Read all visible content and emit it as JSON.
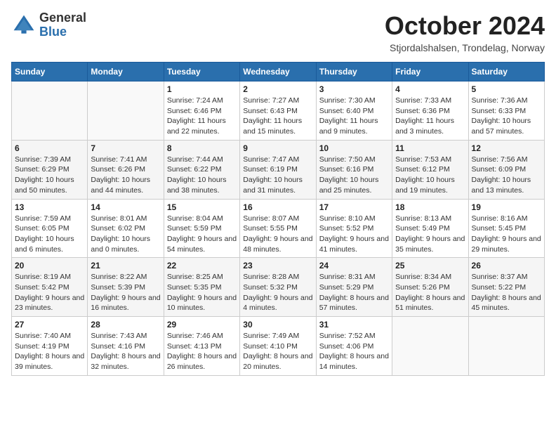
{
  "header": {
    "logo": {
      "general": "General",
      "blue": "Blue"
    },
    "title": "October 2024",
    "location": "Stjordalshalsen, Trondelag, Norway"
  },
  "days_of_week": [
    "Sunday",
    "Monday",
    "Tuesday",
    "Wednesday",
    "Thursday",
    "Friday",
    "Saturday"
  ],
  "weeks": [
    [
      {
        "day": "",
        "info": ""
      },
      {
        "day": "",
        "info": ""
      },
      {
        "day": "1",
        "info": "Sunrise: 7:24 AM\nSunset: 6:46 PM\nDaylight: 11 hours and 22 minutes."
      },
      {
        "day": "2",
        "info": "Sunrise: 7:27 AM\nSunset: 6:43 PM\nDaylight: 11 hours and 15 minutes."
      },
      {
        "day": "3",
        "info": "Sunrise: 7:30 AM\nSunset: 6:40 PM\nDaylight: 11 hours and 9 minutes."
      },
      {
        "day": "4",
        "info": "Sunrise: 7:33 AM\nSunset: 6:36 PM\nDaylight: 11 hours and 3 minutes."
      },
      {
        "day": "5",
        "info": "Sunrise: 7:36 AM\nSunset: 6:33 PM\nDaylight: 10 hours and 57 minutes."
      }
    ],
    [
      {
        "day": "6",
        "info": "Sunrise: 7:39 AM\nSunset: 6:29 PM\nDaylight: 10 hours and 50 minutes."
      },
      {
        "day": "7",
        "info": "Sunrise: 7:41 AM\nSunset: 6:26 PM\nDaylight: 10 hours and 44 minutes."
      },
      {
        "day": "8",
        "info": "Sunrise: 7:44 AM\nSunset: 6:22 PM\nDaylight: 10 hours and 38 minutes."
      },
      {
        "day": "9",
        "info": "Sunrise: 7:47 AM\nSunset: 6:19 PM\nDaylight: 10 hours and 31 minutes."
      },
      {
        "day": "10",
        "info": "Sunrise: 7:50 AM\nSunset: 6:16 PM\nDaylight: 10 hours and 25 minutes."
      },
      {
        "day": "11",
        "info": "Sunrise: 7:53 AM\nSunset: 6:12 PM\nDaylight: 10 hours and 19 minutes."
      },
      {
        "day": "12",
        "info": "Sunrise: 7:56 AM\nSunset: 6:09 PM\nDaylight: 10 hours and 13 minutes."
      }
    ],
    [
      {
        "day": "13",
        "info": "Sunrise: 7:59 AM\nSunset: 6:05 PM\nDaylight: 10 hours and 6 minutes."
      },
      {
        "day": "14",
        "info": "Sunrise: 8:01 AM\nSunset: 6:02 PM\nDaylight: 10 hours and 0 minutes."
      },
      {
        "day": "15",
        "info": "Sunrise: 8:04 AM\nSunset: 5:59 PM\nDaylight: 9 hours and 54 minutes."
      },
      {
        "day": "16",
        "info": "Sunrise: 8:07 AM\nSunset: 5:55 PM\nDaylight: 9 hours and 48 minutes."
      },
      {
        "day": "17",
        "info": "Sunrise: 8:10 AM\nSunset: 5:52 PM\nDaylight: 9 hours and 41 minutes."
      },
      {
        "day": "18",
        "info": "Sunrise: 8:13 AM\nSunset: 5:49 PM\nDaylight: 9 hours and 35 minutes."
      },
      {
        "day": "19",
        "info": "Sunrise: 8:16 AM\nSunset: 5:45 PM\nDaylight: 9 hours and 29 minutes."
      }
    ],
    [
      {
        "day": "20",
        "info": "Sunrise: 8:19 AM\nSunset: 5:42 PM\nDaylight: 9 hours and 23 minutes."
      },
      {
        "day": "21",
        "info": "Sunrise: 8:22 AM\nSunset: 5:39 PM\nDaylight: 9 hours and 16 minutes."
      },
      {
        "day": "22",
        "info": "Sunrise: 8:25 AM\nSunset: 5:35 PM\nDaylight: 9 hours and 10 minutes."
      },
      {
        "day": "23",
        "info": "Sunrise: 8:28 AM\nSunset: 5:32 PM\nDaylight: 9 hours and 4 minutes."
      },
      {
        "day": "24",
        "info": "Sunrise: 8:31 AM\nSunset: 5:29 PM\nDaylight: 8 hours and 57 minutes."
      },
      {
        "day": "25",
        "info": "Sunrise: 8:34 AM\nSunset: 5:26 PM\nDaylight: 8 hours and 51 minutes."
      },
      {
        "day": "26",
        "info": "Sunrise: 8:37 AM\nSunset: 5:22 PM\nDaylight: 8 hours and 45 minutes."
      }
    ],
    [
      {
        "day": "27",
        "info": "Sunrise: 7:40 AM\nSunset: 4:19 PM\nDaylight: 8 hours and 39 minutes."
      },
      {
        "day": "28",
        "info": "Sunrise: 7:43 AM\nSunset: 4:16 PM\nDaylight: 8 hours and 32 minutes."
      },
      {
        "day": "29",
        "info": "Sunrise: 7:46 AM\nSunset: 4:13 PM\nDaylight: 8 hours and 26 minutes."
      },
      {
        "day": "30",
        "info": "Sunrise: 7:49 AM\nSunset: 4:10 PM\nDaylight: 8 hours and 20 minutes."
      },
      {
        "day": "31",
        "info": "Sunrise: 7:52 AM\nSunset: 4:06 PM\nDaylight: 8 hours and 14 minutes."
      },
      {
        "day": "",
        "info": ""
      },
      {
        "day": "",
        "info": ""
      }
    ]
  ]
}
